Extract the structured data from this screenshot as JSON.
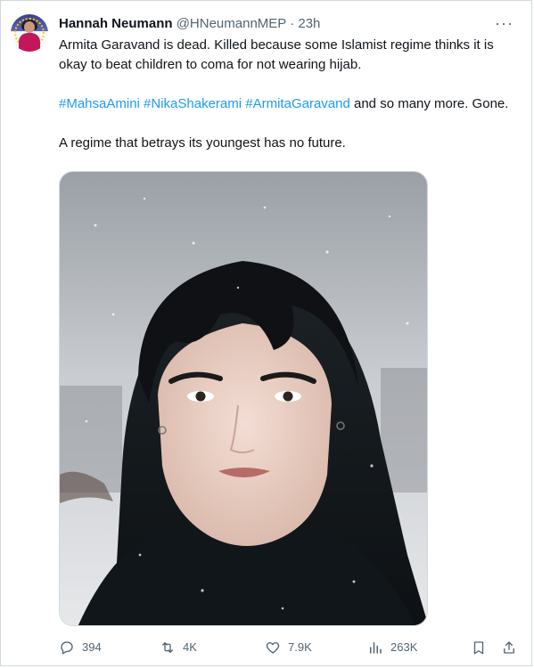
{
  "tweet": {
    "author_name": "Hannah Neumann",
    "author_handle": "@HNeumannMEP",
    "separator": "·",
    "time": "23h",
    "more": "···",
    "line1": "Armita Garavand is dead. Killed because some Islamist regime thinks it is okay to beat children to coma for not wearing hijab.",
    "hashtags": [
      "#MahsaAmini",
      "#NikaShakerami",
      "#ArmitaGaravand"
    ],
    "line2_tail": "and so many more. Gone.",
    "line3": "A regime that betrays its youngest has no future."
  },
  "actions": {
    "replies": "394",
    "reposts": "4K",
    "likes": "7.9K",
    "views": "263K"
  },
  "colors": {
    "link": "#1d9bf0",
    "secondary_text": "#536471",
    "primary_text": "#0f1419"
  },
  "icons": {
    "reply": "reply-icon",
    "repost": "repost-icon",
    "like": "heart-icon",
    "views": "views-icon",
    "bookmark": "bookmark-icon",
    "share": "share-icon",
    "more": "more-icon"
  }
}
